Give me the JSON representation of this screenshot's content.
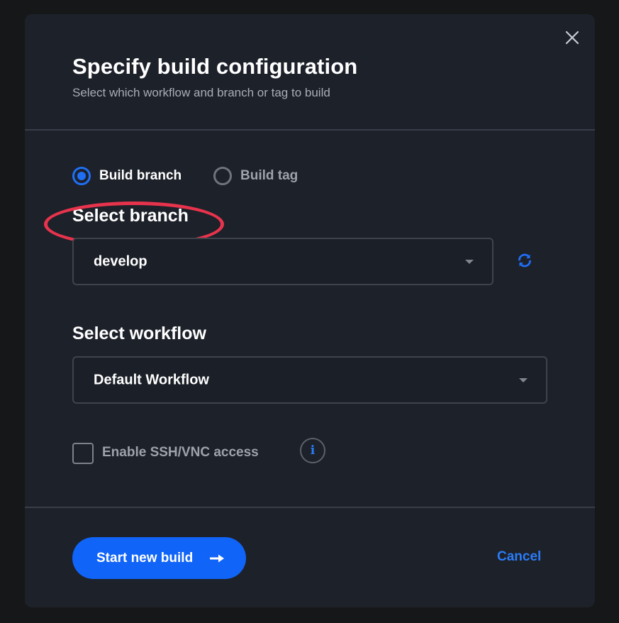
{
  "dialog": {
    "title": "Specify build configuration",
    "subtitle": "Select which workflow and branch or tag to build"
  },
  "build_type": {
    "options": [
      {
        "label": "Build branch",
        "checked": true
      },
      {
        "label": "Build tag",
        "checked": false
      }
    ]
  },
  "branch": {
    "label": "Select branch",
    "selected": "develop"
  },
  "workflow": {
    "label": "Select workflow",
    "selected": "Default Workflow"
  },
  "ssh": {
    "label": "Enable SSH/VNC access",
    "checked": false
  },
  "footer": {
    "start_label": "Start new build",
    "cancel_label": "Cancel"
  },
  "icons": [
    "close-icon",
    "chevron-down-icon",
    "refresh-icon",
    "info-icon",
    "arrow-right-icon"
  ],
  "colors": {
    "accent": "#1064f7",
    "link": "#2a7cf7",
    "annotation": "#e8334c",
    "background": "#1d212a"
  }
}
